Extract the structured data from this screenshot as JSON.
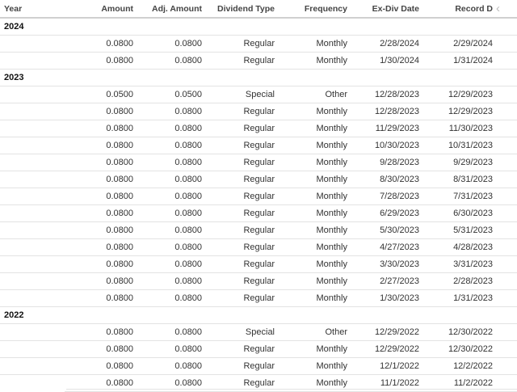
{
  "columns": [
    "Year",
    "Amount",
    "Adj. Amount",
    "Dividend Type",
    "Frequency",
    "Ex-Div Date",
    "Record D"
  ],
  "groups": [
    {
      "year": "2024",
      "rows": [
        [
          "0.0800",
          "0.0800",
          "Regular",
          "Monthly",
          "2/28/2024",
          "2/29/2024"
        ],
        [
          "0.0800",
          "0.0800",
          "Regular",
          "Monthly",
          "1/30/2024",
          "1/31/2024"
        ]
      ]
    },
    {
      "year": "2023",
      "rows": [
        [
          "0.0500",
          "0.0500",
          "Special",
          "Other",
          "12/28/2023",
          "12/29/2023"
        ],
        [
          "0.0800",
          "0.0800",
          "Regular",
          "Monthly",
          "12/28/2023",
          "12/29/2023"
        ],
        [
          "0.0800",
          "0.0800",
          "Regular",
          "Monthly",
          "11/29/2023",
          "11/30/2023"
        ],
        [
          "0.0800",
          "0.0800",
          "Regular",
          "Monthly",
          "10/30/2023",
          "10/31/2023"
        ],
        [
          "0.0800",
          "0.0800",
          "Regular",
          "Monthly",
          "9/28/2023",
          "9/29/2023"
        ],
        [
          "0.0800",
          "0.0800",
          "Regular",
          "Monthly",
          "8/30/2023",
          "8/31/2023"
        ],
        [
          "0.0800",
          "0.0800",
          "Regular",
          "Monthly",
          "7/28/2023",
          "7/31/2023"
        ],
        [
          "0.0800",
          "0.0800",
          "Regular",
          "Monthly",
          "6/29/2023",
          "6/30/2023"
        ],
        [
          "0.0800",
          "0.0800",
          "Regular",
          "Monthly",
          "5/30/2023",
          "5/31/2023"
        ],
        [
          "0.0800",
          "0.0800",
          "Regular",
          "Monthly",
          "4/27/2023",
          "4/28/2023"
        ],
        [
          "0.0800",
          "0.0800",
          "Regular",
          "Monthly",
          "3/30/2023",
          "3/31/2023"
        ],
        [
          "0.0800",
          "0.0800",
          "Regular",
          "Monthly",
          "2/27/2023",
          "2/28/2023"
        ],
        [
          "0.0800",
          "0.0800",
          "Regular",
          "Monthly",
          "1/30/2023",
          "1/31/2023"
        ]
      ]
    },
    {
      "year": "2022",
      "rows": [
        [
          "0.0800",
          "0.0800",
          "Special",
          "Other",
          "12/29/2022",
          "12/30/2022"
        ],
        [
          "0.0800",
          "0.0800",
          "Regular",
          "Monthly",
          "12/29/2022",
          "12/30/2022"
        ],
        [
          "0.0800",
          "0.0800",
          "Regular",
          "Monthly",
          "12/1/2022",
          "12/2/2022"
        ],
        [
          "0.0800",
          "0.0800",
          "Regular",
          "Monthly",
          "11/1/2022",
          "11/2/2022"
        ]
      ]
    }
  ],
  "icons": {
    "scroll_left": "chevron-left-icon"
  }
}
